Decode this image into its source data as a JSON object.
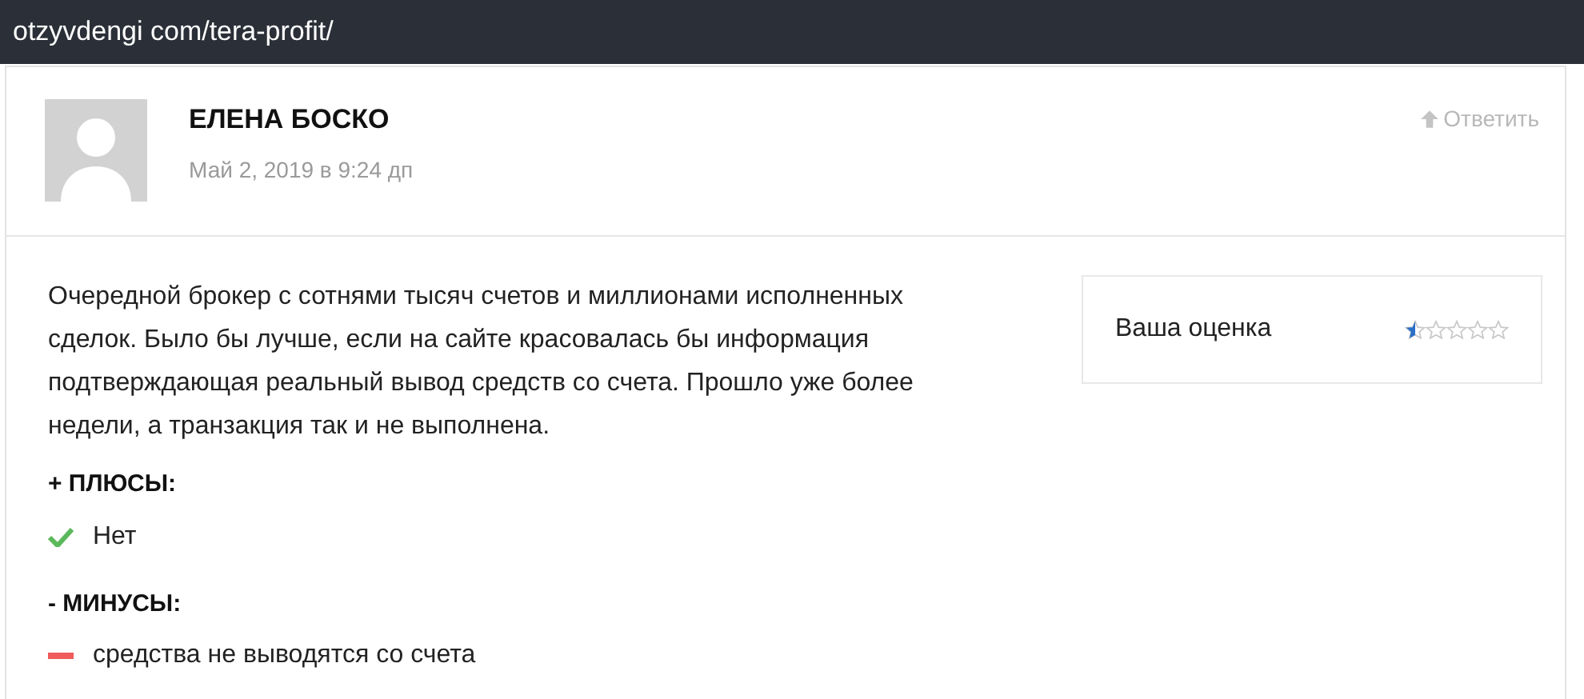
{
  "url_bar": {
    "text": "otzyvdengi com/tera-profit/"
  },
  "comment": {
    "author": "ЕЛЕНА БОСКО",
    "date": "Май 2, 2019 в 9:24 дп",
    "reply": "Ответить",
    "body": "Очередной брокер с сотнями тысяч счетов и миллионами исполненных сделок. Было бы лучше, если на сайте красовалась бы информация подтверждающая реальный вывод средств со счета. Прошло уже более недели, а транзакция так и не выполнена.",
    "rating": {
      "label": "Ваша оценка",
      "stars": 0.5
    },
    "sections": [
      {
        "kind": "pros",
        "title": "+ ПЛЮСЫ:",
        "items": [
          "Нет"
        ]
      },
      {
        "kind": "cons",
        "title": "- МИНУСЫ:",
        "items": [
          "средства не выводятся со счета"
        ]
      }
    ]
  }
}
